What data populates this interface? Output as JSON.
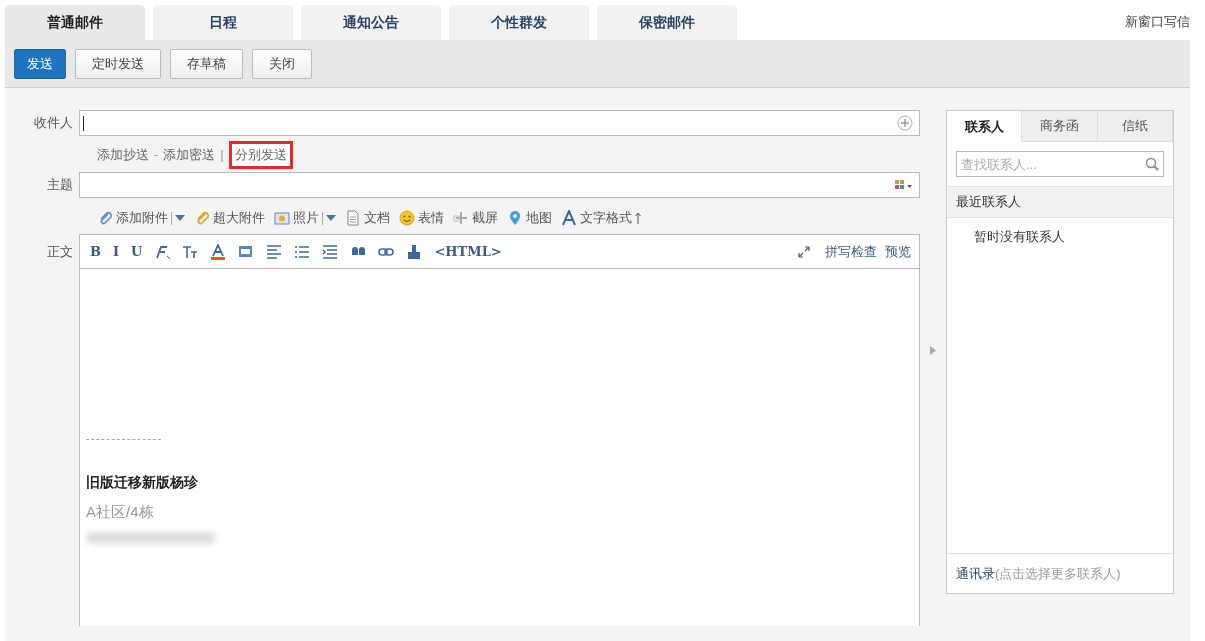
{
  "tabs": [
    {
      "label": "普通邮件",
      "selected": true
    },
    {
      "label": "日程",
      "selected": false
    },
    {
      "label": "通知公告",
      "selected": false
    },
    {
      "label": "个性群发",
      "selected": false
    },
    {
      "label": "保密邮件",
      "selected": false
    }
  ],
  "new_window_link": "新窗口写信",
  "toolbar": [
    {
      "label": "发送",
      "kind": "primary"
    },
    {
      "label": "定时发送",
      "kind": "default"
    },
    {
      "label": "存草稿",
      "kind": "default"
    },
    {
      "label": "关闭",
      "kind": "default"
    }
  ],
  "recipient": {
    "label": "收件人"
  },
  "recipient_links": [
    {
      "kind": "link",
      "text": "添加抄送",
      "highlighted": false
    },
    {
      "kind": "sep",
      "text": "-"
    },
    {
      "kind": "link",
      "text": "添加密送",
      "highlighted": false
    },
    {
      "kind": "sep",
      "text": "|"
    },
    {
      "kind": "link",
      "text": "分别发送",
      "highlighted": true
    }
  ],
  "subject": {
    "label": "主题"
  },
  "attach_toolbar": [
    {
      "kind": "clip",
      "label": "添加附件",
      "dropdown": true
    },
    {
      "kind": "bigclip",
      "label": "超大附件",
      "dropdown": false
    },
    {
      "kind": "photo",
      "label": "照片",
      "dropdown": true
    },
    {
      "kind": "doc",
      "label": "文档",
      "dropdown": false
    },
    {
      "kind": "smiley",
      "label": "表情",
      "dropdown": false
    },
    {
      "kind": "screenshot",
      "label": "截屏",
      "dropdown": false
    },
    {
      "kind": "map",
      "label": "地图",
      "dropdown": false
    },
    {
      "kind": "format",
      "label": "文字格式",
      "dropdown": false
    }
  ],
  "body_label": "正文",
  "editor_toolbar": [
    {
      "kind": "text",
      "label": "B"
    },
    {
      "kind": "text",
      "label": "I"
    },
    {
      "kind": "text",
      "label": "U"
    },
    {
      "kind": "clear"
    },
    {
      "kind": "size"
    },
    {
      "kind": "color"
    },
    {
      "kind": "highlight"
    },
    {
      "kind": "align"
    },
    {
      "kind": "list"
    },
    {
      "kind": "indent"
    },
    {
      "kind": "quote"
    },
    {
      "kind": "link"
    },
    {
      "kind": "brush"
    },
    {
      "kind": "text",
      "label": "<HTML>"
    }
  ],
  "editor_actions": [
    "拼写检查",
    "预览"
  ],
  "signature": {
    "name": "旧版迁移新版杨珍",
    "address": "A社区/4栋"
  },
  "contacts_panel": {
    "tabs": [
      {
        "label": "联系人",
        "selected": true
      },
      {
        "label": "商务函",
        "selected": false
      },
      {
        "label": "信纸",
        "selected": false
      }
    ],
    "search_placeholder": "查找联系人...",
    "section_title": "最近联系人",
    "empty_text": "暂时没有联系人",
    "footer_link": "通讯录",
    "footer_hint": "(点击选择更多联系人)"
  }
}
